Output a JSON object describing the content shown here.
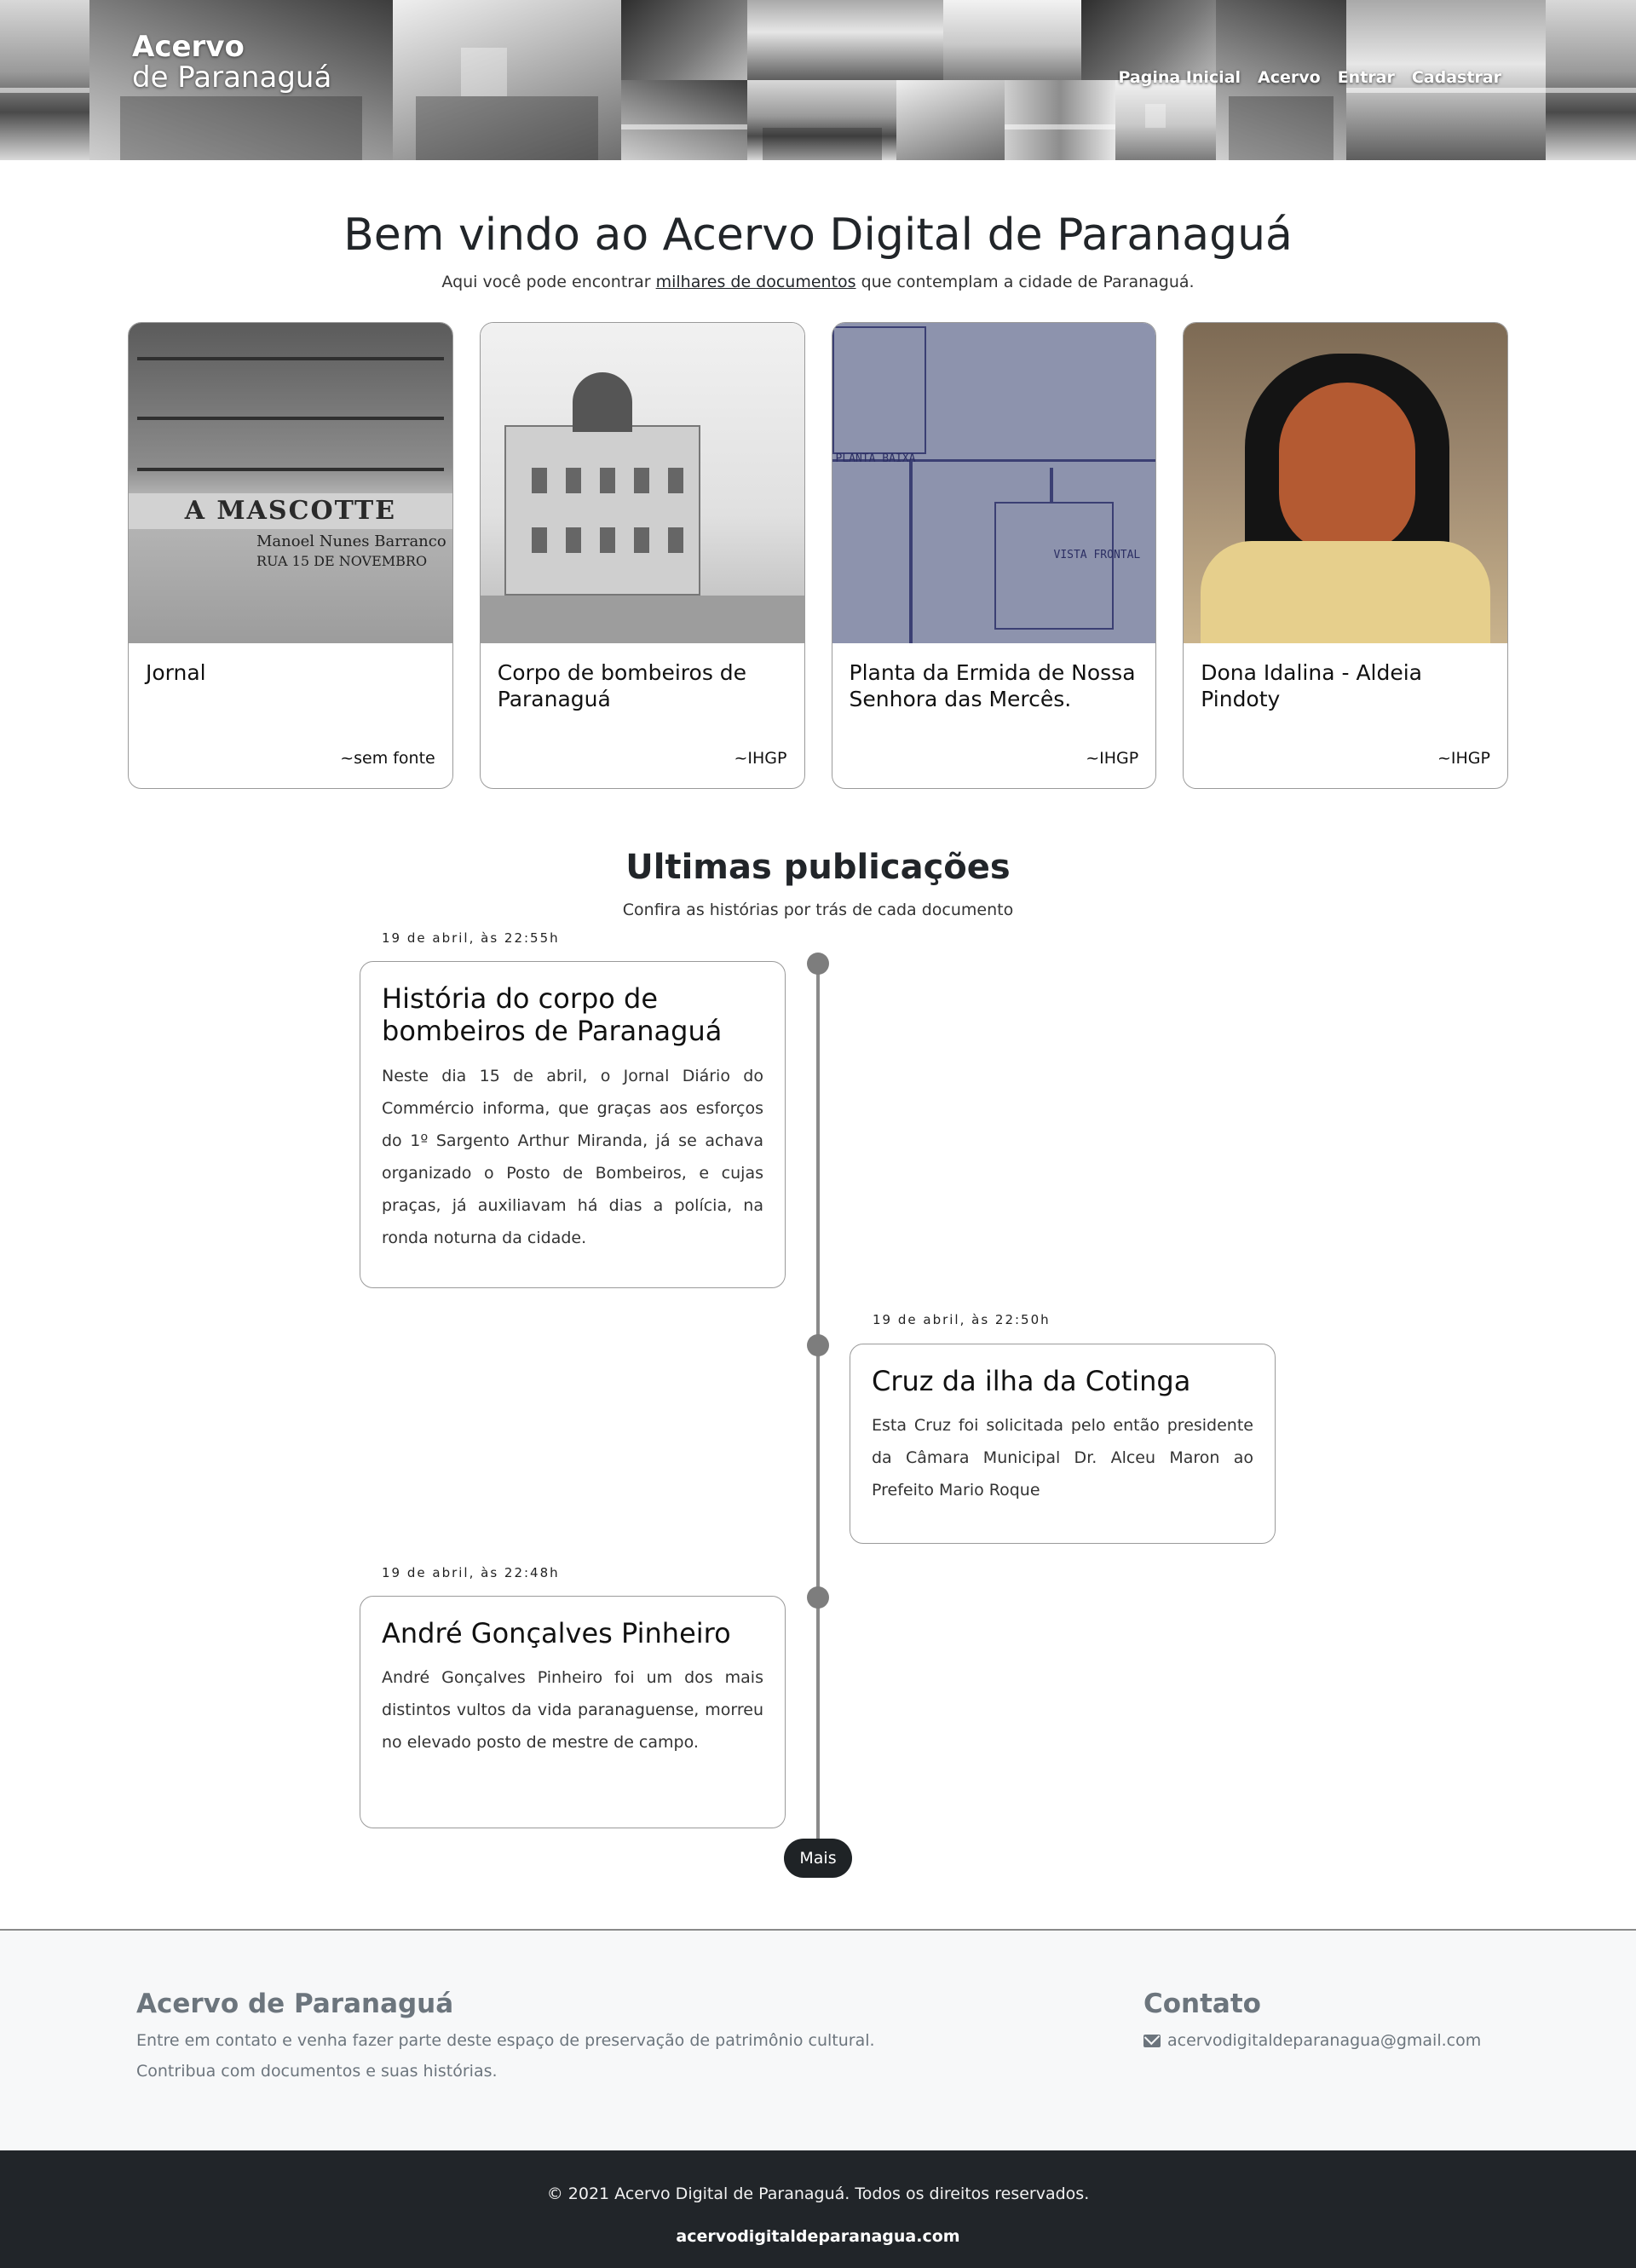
{
  "header": {
    "brand_line1": "Acervo",
    "brand_line2": "de Paranaguá",
    "nav": [
      "Pagina Inicial",
      "Acervo",
      "Entrar",
      "Cadastrar"
    ]
  },
  "hero": {
    "title": "Bem vindo ao Acervo Digital de Paranaguá",
    "subtitle_before": "Aqui você pode encontrar ",
    "subtitle_link": "milhares de documentos",
    "subtitle_after": " que contemplam a cidade de Paranaguá."
  },
  "cards": [
    {
      "title": "Jornal",
      "source": "~sem fonte",
      "image_icon": "newspaper-photo",
      "image_text_1": "A MASCOTTE",
      "image_text_2": "Manoel Nunes Barranco",
      "image_text_3": "RUA 15 DE NOVEMBRO"
    },
    {
      "title": "Corpo de bombeiros de Paranaguá",
      "source": "~IHGP",
      "image_icon": "fire-station-photo"
    },
    {
      "title": "Planta da Ermida de Nossa Senhora das Mercês.",
      "source": "~IHGP",
      "image_icon": "blueprint-photo",
      "image_text_1": "PLANTA BAIXA",
      "image_text_2": "VISTA FRONTAL"
    },
    {
      "title": "Dona Idalina - Aldeia Pindoty",
      "source": "~IHGP",
      "image_icon": "portrait-photo"
    }
  ],
  "publications": {
    "title": "Ultimas publicações",
    "subtitle": "Confira as histórias por trás de cada documento",
    "posts": [
      {
        "timestamp": "19 de abril, às 22:55h",
        "title": "História do corpo de bombeiros de Paranaguá",
        "excerpt": "Neste dia 15 de abril, o Jornal Diário do Commércio informa, que graças aos esforços do 1º Sargento Arthur Miranda, já se achava organizado o Posto de Bombeiros, e cujas praças, já auxiliavam há dias a polícia, na ronda noturna da cidade."
      },
      {
        "timestamp": "19 de abril, às 22:50h",
        "title": "Cruz da ilha da Cotinga",
        "excerpt": "Esta Cruz foi solicitada pelo então presidente da Câmara Municipal Dr. Alceu Maron ao Prefeito Mario Roque"
      },
      {
        "timestamp": "19 de abril, às 22:48h",
        "title": "André Gonçalves Pinheiro",
        "excerpt": "André Gonçalves Pinheiro foi um dos mais distintos vultos da vida paranaguense, morreu no elevado posto de mestre de campo."
      }
    ],
    "more_label": "Mais"
  },
  "footer": {
    "brand": "Acervo de Paranaguá",
    "text_line1": "Entre em contato e venha fazer parte deste espaço de preservação de patrimônio cultural.",
    "text_line2": "Contribua com documentos e suas histórias.",
    "contact_title": "Contato",
    "email": "acervodigitaldeparanagua@gmail.com",
    "copyright": "© 2021 Acervo Digital de Paranaguá. Todos os direitos reservados.",
    "site": "acervodigitaldeparanagua.com"
  },
  "colors": {
    "text": "#212529",
    "muted": "#6c757d",
    "footer_bg": "#212529",
    "footer_top_bg": "#f7f8f9",
    "timeline": "#8a8a8a"
  }
}
